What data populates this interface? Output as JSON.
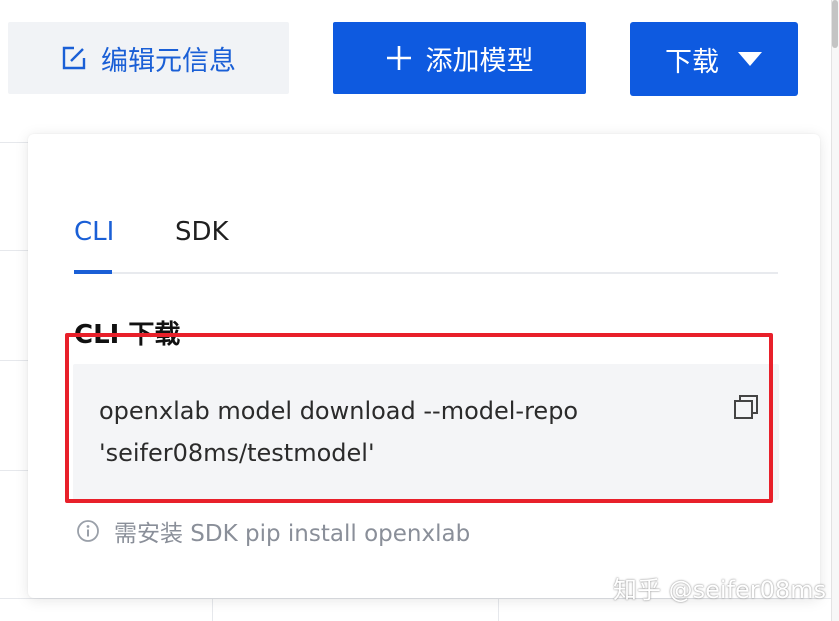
{
  "toolbar": {
    "edit_label": "编辑元信息",
    "add_model_label": "添加模型",
    "download_label": "下载"
  },
  "popover": {
    "tabs": [
      {
        "label": "CLI",
        "active": true
      },
      {
        "label": "SDK",
        "active": false
      }
    ],
    "section_title": "CLI 下载",
    "command": "openxlab model download --model-repo\n'seifer08ms/testmodel'",
    "hint": "需安装 SDK pip install openxlab"
  },
  "watermark": "知乎 @seifer08ms",
  "colors": {
    "primary": "#0e5ae0",
    "link": "#1a5fd6",
    "annotation": "#e8202a"
  },
  "icons": {
    "edit": "edit-icon",
    "add": "plus-icon",
    "caret": "caret-down-icon",
    "copy": "copy-icon",
    "info": "info-icon"
  }
}
